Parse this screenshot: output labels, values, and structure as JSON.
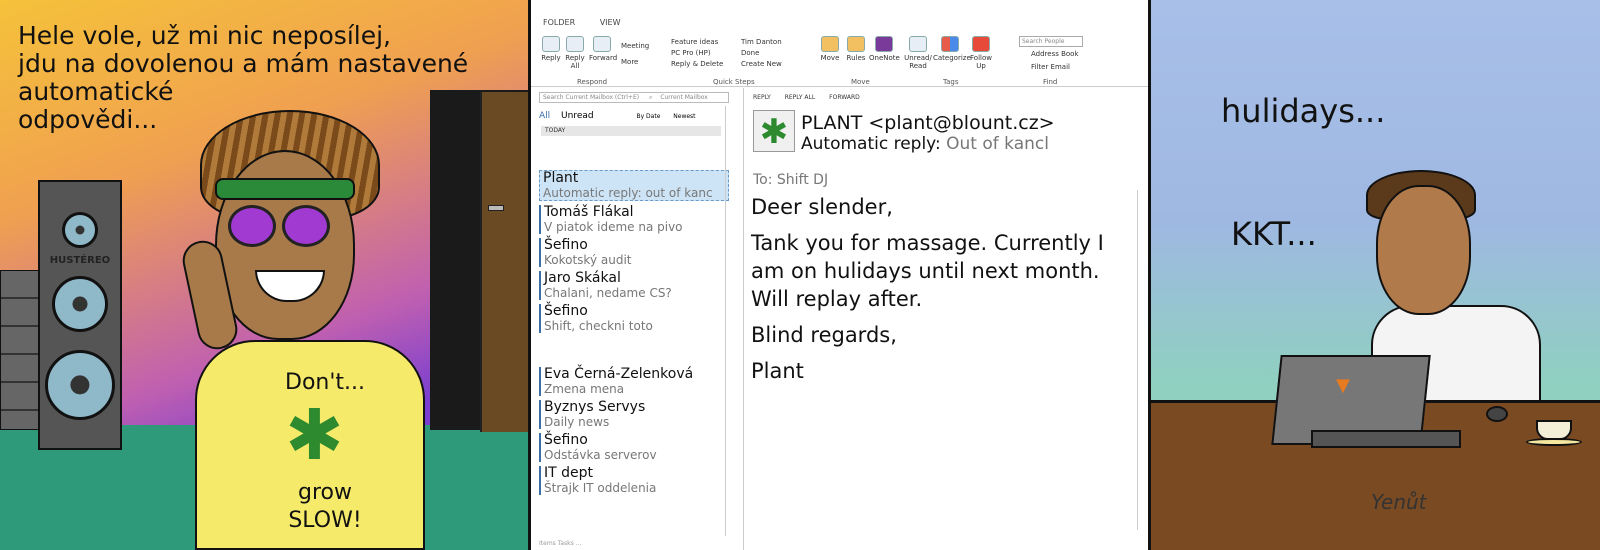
{
  "panel1": {
    "caption_lines": [
      "Hele vole, už mi nic neposílej,",
      "jdu na dovolenou a mám nastavené",
      "automatické",
      "odpovědi..."
    ],
    "speaker_label": "HUSTÉREO",
    "shirt_top": "Don't...",
    "shirt_mid": "grow",
    "shirt_bottom": "SLOW!"
  },
  "outlook": {
    "ribbon_tabs": [
      "FOLDER",
      "VIEW"
    ],
    "respond": {
      "reply": "Reply",
      "reply_all": "Reply All",
      "forward": "Forward",
      "meeting": "Meeting",
      "more": "More",
      "group": "Respond"
    },
    "quick_steps": {
      "items": [
        "Feature ideas",
        "PC Pro (HP)",
        "Reply & Delete",
        "Tim Danton",
        "Done",
        "Create New"
      ],
      "group": "Quick Steps"
    },
    "move": {
      "move": "Move",
      "rules": "Rules",
      "onenote": "OneNote",
      "group": "Move"
    },
    "tags": {
      "unread": "Unread/ Read",
      "categorize": "Categorize",
      "follow": "Follow Up",
      "group": "Tags"
    },
    "find": {
      "search_people": "Search People",
      "address_book": "Address Book",
      "filter_email": "Filter Email",
      "group": "Find"
    },
    "mail_search_placeholder": "Search Current Mailbox (Ctrl+E)",
    "mailbox_scope": "Current Mailbox",
    "filters": {
      "all": "All",
      "unread": "Unread",
      "by_date": "By Date",
      "newest": "Newest"
    },
    "today_label": "TODAY",
    "messages": [
      {
        "from": "Plant",
        "subject": "Automatic reply: out of kanc"
      },
      {
        "from": "Tomáš Flákal",
        "subject": "V piatok ideme na pivo"
      },
      {
        "from": "Šefino",
        "subject": "Kokotský audit"
      },
      {
        "from": "Jaro Skákal",
        "subject": "Chalani, nedame CS?"
      },
      {
        "from": "Šefino",
        "subject": "Shift, checkni toto"
      }
    ],
    "messages2": [
      {
        "from": "Eva Černá-Zelenková",
        "subject": "Zmena mena"
      },
      {
        "from": "Byznys Servys",
        "subject": "Daily news"
      },
      {
        "from": "Šefino",
        "subject": "Odstávka serverov"
      },
      {
        "from": "IT dept",
        "subject": "Štrajk IT oddelenia"
      }
    ],
    "read_actions": {
      "reply": "REPLY",
      "reply_all": "REPLY ALL",
      "forward": "FORWARD"
    },
    "sender": "PLANT <plant@blount.cz>",
    "subject_prefix": "Automatic reply:",
    "subject_rest": "Out of kancl",
    "to": "To: Shift DJ",
    "body": [
      "Deer slender,",
      "Tank you for massage. Currently I am on hulidays until next month. Will replay after.",
      "Blind regards,",
      "Plant"
    ],
    "status": "Items  Tasks  ..."
  },
  "panel3": {
    "text1": "hulidays...",
    "text2": "KKT...",
    "signature": "Yenůt"
  }
}
